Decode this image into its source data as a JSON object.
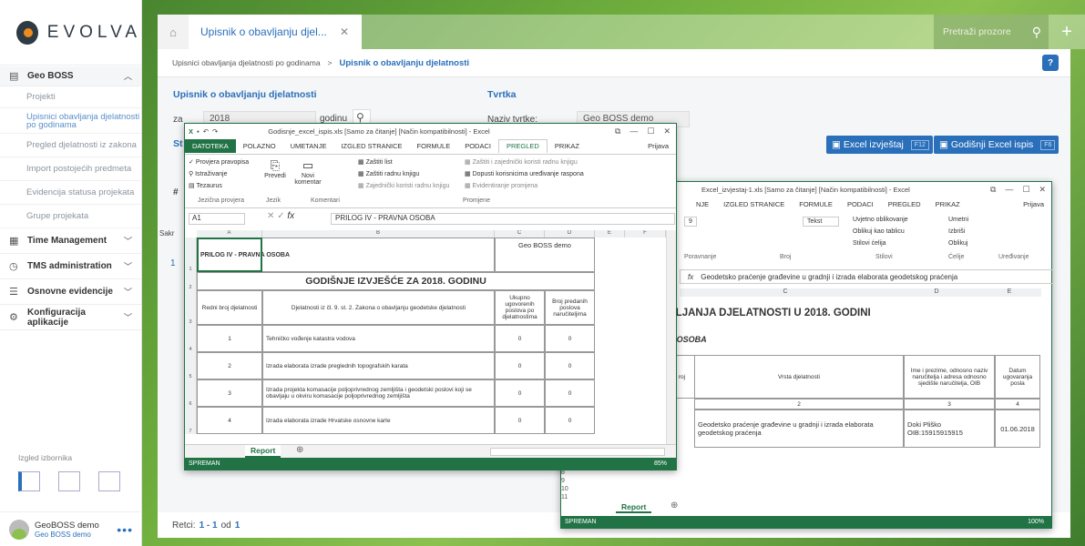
{
  "logo": "EVOLVA",
  "sidebar": {
    "section1": "Geo BOSS",
    "sub": [
      "Projekti",
      "Upisnici obavljanja djelatnosti po godinama",
      "Pregled djelatnosti iz zakona",
      "Import postojećih predmeta",
      "Evidencija statusa projekata",
      "Grupe projekata"
    ],
    "sections": [
      "Time Management",
      "TMS administration",
      "Osnovne evidencije",
      "Konfiguracija aplikacije"
    ],
    "izgled": "Izgled izbornika",
    "user_name": "GeoBOSS demo",
    "user_org": "Geo BOSS demo"
  },
  "tabs": {
    "tab1": "Upisnik o obavljanju djel...",
    "search": "Pretraži prozore"
  },
  "breadcrumb": {
    "parent": "Upisnici obavljanja djelatnosti po godinama",
    "sep": ">",
    "current": "Upisnik o obavljanju djelatnosti"
  },
  "form": {
    "title": "Upisnik o obavljanju djelatnosti",
    "za_label": "za",
    "year": "2018",
    "godinu": "godinu",
    "tvrtka_title": "Tvrtka",
    "naziv_label": "Naziv tvrtke:",
    "naziv_value": "Geo BOSS demo",
    "st": "St",
    "hash": "#",
    "sakr": "Sakr",
    "one": "1"
  },
  "buttons": {
    "excel": "Excel izvještaj",
    "excel_key": "F12",
    "godisnji": "Godišnji Excel ispis",
    "godisnji_key": "F6"
  },
  "footer": {
    "label": "Retci:",
    "range": "1 - 1",
    "od": "od",
    "total": "1"
  },
  "xl1": {
    "title": "Godisnje_excel_ispis.xls [Samo za čitanje] [Način kompatibilnosti] - Excel",
    "tabs": [
      "DATOTEKA",
      "POLAZNO",
      "UMETANJE",
      "IZGLED STRANICE",
      "FORMULE",
      "PODACI",
      "PREGLED",
      "PRIKAZ"
    ],
    "prijava": "Prijava",
    "rib_a": [
      "Provjera pravopisa",
      "Istraživanje",
      "Tezaurus"
    ],
    "grp_a": "Jezična provjera",
    "rib_b": "Prevedi",
    "grp_b": "Jezik",
    "rib_c": "Novi komentar",
    "grp_c": "Komentari",
    "rib_d": [
      "Zaštiti list",
      "Zaštiti radnu knjigu",
      "Zajednički koristi radnu knjigu"
    ],
    "rib_e": [
      "Zaštiti i zajednički koristi radnu knjigu",
      "Dopusti korisnicima uređivanje raspona",
      "Evidentiranje promjena"
    ],
    "grp_e": "Promjene",
    "namebox": "A1",
    "formula": "PRILOG IV - PRAVNA OSOBA",
    "cols": [
      "A",
      "B",
      "C",
      "D",
      "E",
      "F"
    ],
    "prilog": "PRILOG IV - PRAVNA OSOBA",
    "company": "Geo BOSS demo",
    "heading": "GODIŠNJE IZVJEŠĆE ZA 2018. GODINU",
    "h1": "Redni broj djelatnosti",
    "h2": "Djelatnosti iz čl. 9. st. 2. Zakona o obavljanju geodetske djelatnosti",
    "h3": "Ukupno ugovorenih poslova po djelatnostima",
    "h4": "Broj predanih poslova naručiteljima",
    "rows": [
      {
        "n": "1",
        "t": "Tehničko vođenje katastra vodova",
        "a": "0",
        "b": "0"
      },
      {
        "n": "2",
        "t": "Izrada elaborata izrade preglednih topografskih karata",
        "a": "0",
        "b": "0"
      },
      {
        "n": "3",
        "t": "Izrada projekta komasacije poljoprivrednog zemljišta i geodetski poslovi koji se obavljaju u okviru komasacije poljoprivrednog zemljišta",
        "a": "0",
        "b": "0"
      },
      {
        "n": "4",
        "t": "Izrada elaborata izrade Hrvatske osnovne karte",
        "a": "0",
        "b": "0"
      }
    ],
    "sheet": "Report",
    "status": "SPREMAN",
    "zoom": "85%"
  },
  "xl2": {
    "title": "Excel_izvjestaj-1.xls [Samo za čitanje] [Način kompatibilnosti] - Excel",
    "tabs": [
      "NJE",
      "IZGLED STRANICE",
      "FORMULE",
      "PODACI",
      "PREGLED",
      "PRIKAZ"
    ],
    "prijava": "Prijava",
    "font_size": "9",
    "fmt": "Tekst",
    "rib": [
      "Uvjetno oblikovanje",
      "Oblikuj kao tablicu",
      "Stilovi ćelija",
      "Umetni",
      "Izbriši",
      "Oblikuj"
    ],
    "grps": [
      "Poravnanje",
      "Broj",
      "Stilovi",
      "Ćelije",
      "Uređivanje"
    ],
    "formula": "Geodetsko praćenje građevine u gradnji i izrada elaborata geodetskog praćenja",
    "cols": [
      "C",
      "D",
      "E"
    ],
    "heading": "VLJANJA DJELATNOSTI U 2018. GODINI",
    "sub": "A OSOBA",
    "h_roj": "roj",
    "h_vrsta": "Vrsta djelatnosti",
    "h_ime": "Ime i prezime, odnosno naziv naručitelja i adresa odnosno sjedište naručitelja, OIB",
    "h_datum": "Datum ugovaranja posla",
    "n2": "2",
    "n3": "3",
    "n4": "4",
    "r_vrsta": "Geodetsko praćenje građevine u gradnji i izrada elaborata geodetskog praćenja",
    "r_ime": "Doki Pliško OIB:15915915915",
    "r_datum": "01.06.2018",
    "rownums": [
      "8",
      "9",
      "10",
      "11"
    ],
    "sheet": "Report",
    "status": "SPREMAN",
    "zoom": "100%"
  }
}
